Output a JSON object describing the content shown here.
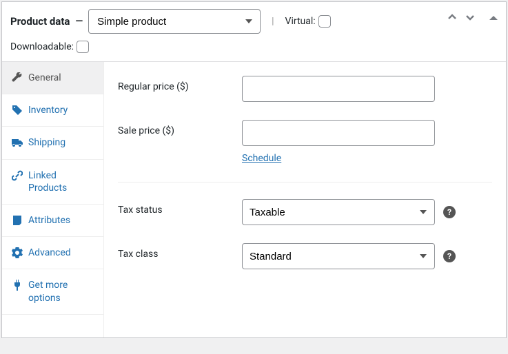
{
  "header": {
    "title": "Product data",
    "dash": "—",
    "product_type": "Simple product",
    "virtual_label": "Virtual:",
    "downloadable_label": "Downloadable:"
  },
  "sidebar": {
    "tabs": [
      {
        "label": "General",
        "icon": "wrench-icon",
        "active": true
      },
      {
        "label": "Inventory",
        "icon": "tag-icon",
        "active": false
      },
      {
        "label": "Shipping",
        "icon": "truck-icon",
        "active": false
      },
      {
        "label": "Linked Products",
        "icon": "link-icon",
        "active": false
      },
      {
        "label": "Attributes",
        "icon": "note-icon",
        "active": false
      },
      {
        "label": "Advanced",
        "icon": "gear-icon",
        "active": false
      },
      {
        "label": "Get more options",
        "icon": "plug-icon",
        "active": false
      }
    ]
  },
  "fields": {
    "regular_price_label": "Regular price ($)",
    "regular_price_value": "",
    "sale_price_label": "Sale price ($)",
    "sale_price_value": "",
    "schedule_link": "Schedule",
    "tax_status_label": "Tax status",
    "tax_status_value": "Taxable",
    "tax_class_label": "Tax class",
    "tax_class_value": "Standard"
  }
}
